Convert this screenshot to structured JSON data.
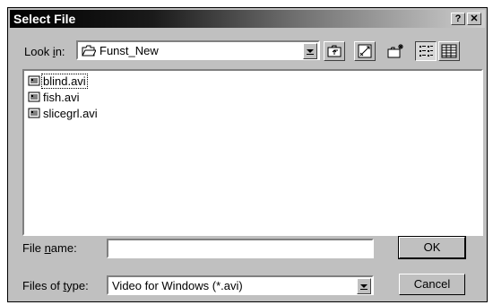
{
  "window": {
    "title": "Select File",
    "help_label": "?",
    "close_label": "✕"
  },
  "look_in": {
    "label_pre": "Look ",
    "label_accel": "i",
    "label_post": "n:",
    "value": "Funst_New",
    "icon": "folder-open-icon"
  },
  "toolbar": {
    "buttons": [
      {
        "name": "up-one-level-button",
        "icon": "up-folder-icon"
      },
      {
        "name": "desktop-button",
        "icon": "desktop-icon"
      },
      {
        "name": "new-folder-button",
        "icon": "new-folder-icon"
      },
      {
        "name": "list-view-button",
        "icon": "list-view-icon",
        "pressed": true
      },
      {
        "name": "details-view-button",
        "icon": "details-view-icon"
      }
    ]
  },
  "files": [
    {
      "name": "blind.avi",
      "icon": "video-file-icon",
      "focused": true
    },
    {
      "name": "fish.avi",
      "icon": "video-file-icon"
    },
    {
      "name": "slicegrl.avi",
      "icon": "video-file-icon"
    }
  ],
  "file_name": {
    "label_pre": "File ",
    "label_accel": "n",
    "label_post": "ame:",
    "value": ""
  },
  "file_type": {
    "label_pre": "Files of ",
    "label_accel": "t",
    "label_post": "ype:",
    "value": "Video for Windows (*.avi)"
  },
  "buttons": {
    "ok": "OK",
    "cancel": "Cancel"
  },
  "colors": {
    "face": "#c0c0c0",
    "titlebar_start": "#000000",
    "titlebar_end": "#cfcfcf"
  }
}
